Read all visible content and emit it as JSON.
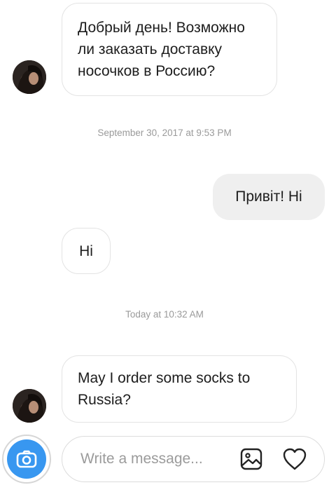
{
  "messages": [
    {
      "direction": "incoming",
      "text": "Добрый день! Возможно ли заказать доставку носочков в Россию?"
    },
    {
      "direction": "outgoing",
      "text": "Привіт! Hi"
    },
    {
      "direction": "incoming",
      "text": "Hi"
    },
    {
      "direction": "incoming",
      "text": "May I order some socks to Russia?"
    }
  ],
  "timestamps": {
    "first": "September 30, 2017 at 9:53 PM",
    "second": "Today at 10:32 AM"
  },
  "composer": {
    "placeholder": "Write a message...",
    "camera_icon": "camera-icon",
    "gallery_icon": "image-icon",
    "like_icon": "heart-icon"
  },
  "colors": {
    "accent": "#3897f0",
    "outgoing_bubble": "#efefef",
    "incoming_border": "#e3e3e3",
    "timestamp": "#9a9a9a"
  }
}
